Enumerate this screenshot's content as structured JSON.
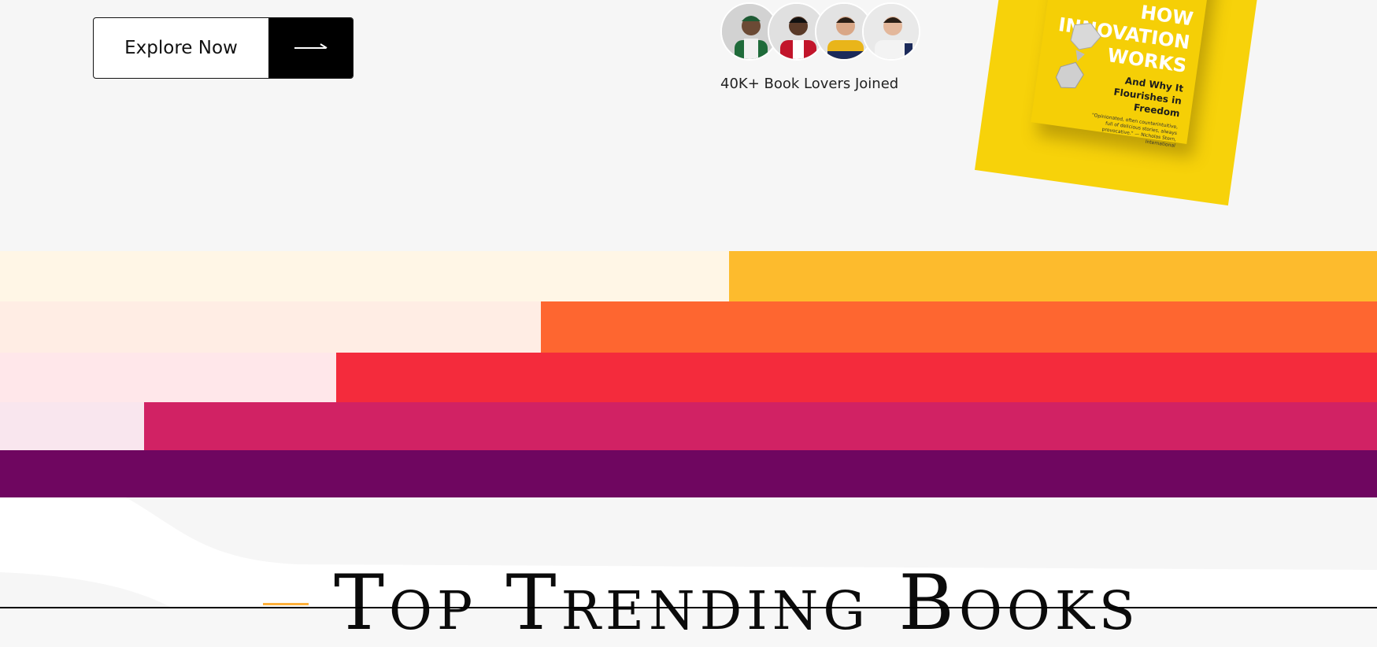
{
  "hero": {
    "cta_label": "Explore Now",
    "cta_arrow_icon": "long-arrow-right-icon",
    "social_proof": "40K+ Book Lovers Joined",
    "avatars": [
      {
        "name": "avatar-1",
        "shirt": "#1f6b3a",
        "skin": "#6b4a35",
        "hair": "#1a1a1a"
      },
      {
        "name": "avatar-2",
        "shirt": "#c2152b",
        "skin": "#5a3a28",
        "hair": "#111111"
      },
      {
        "name": "avatar-3",
        "shirt": "#e9b51a",
        "skin": "#d9a787",
        "hair": "#2a1e16"
      },
      {
        "name": "avatar-4",
        "shirt": "#f3f3f3",
        "skin": "#e3b79b",
        "hair": "#2a1e16"
      }
    ],
    "book": {
      "title_lines": [
        "HOW",
        "INNOVATION",
        "WORKS"
      ],
      "subtitle_lines": [
        "And Why It",
        "Flourishes in",
        "Freedom"
      ],
      "quote": "\"Opinionated, often counterintuitive, full of delicious stories, always provocative.\" — Nicholas Stern, International",
      "color": "#f7d20a"
    }
  },
  "stripes": [
    {
      "light": "#fff6e6",
      "dark": "#fdbb2d"
    },
    {
      "light": "#ffede4",
      "dark": "#fe6630"
    },
    {
      "light": "#ffe7ea",
      "dark": "#f42b3c"
    },
    {
      "light": "#f9e6ee",
      "dark": "#d12264"
    },
    {
      "light": "#6f0660",
      "dark": "#6f0660"
    }
  ],
  "section": {
    "heading": "Top Trending Books"
  }
}
